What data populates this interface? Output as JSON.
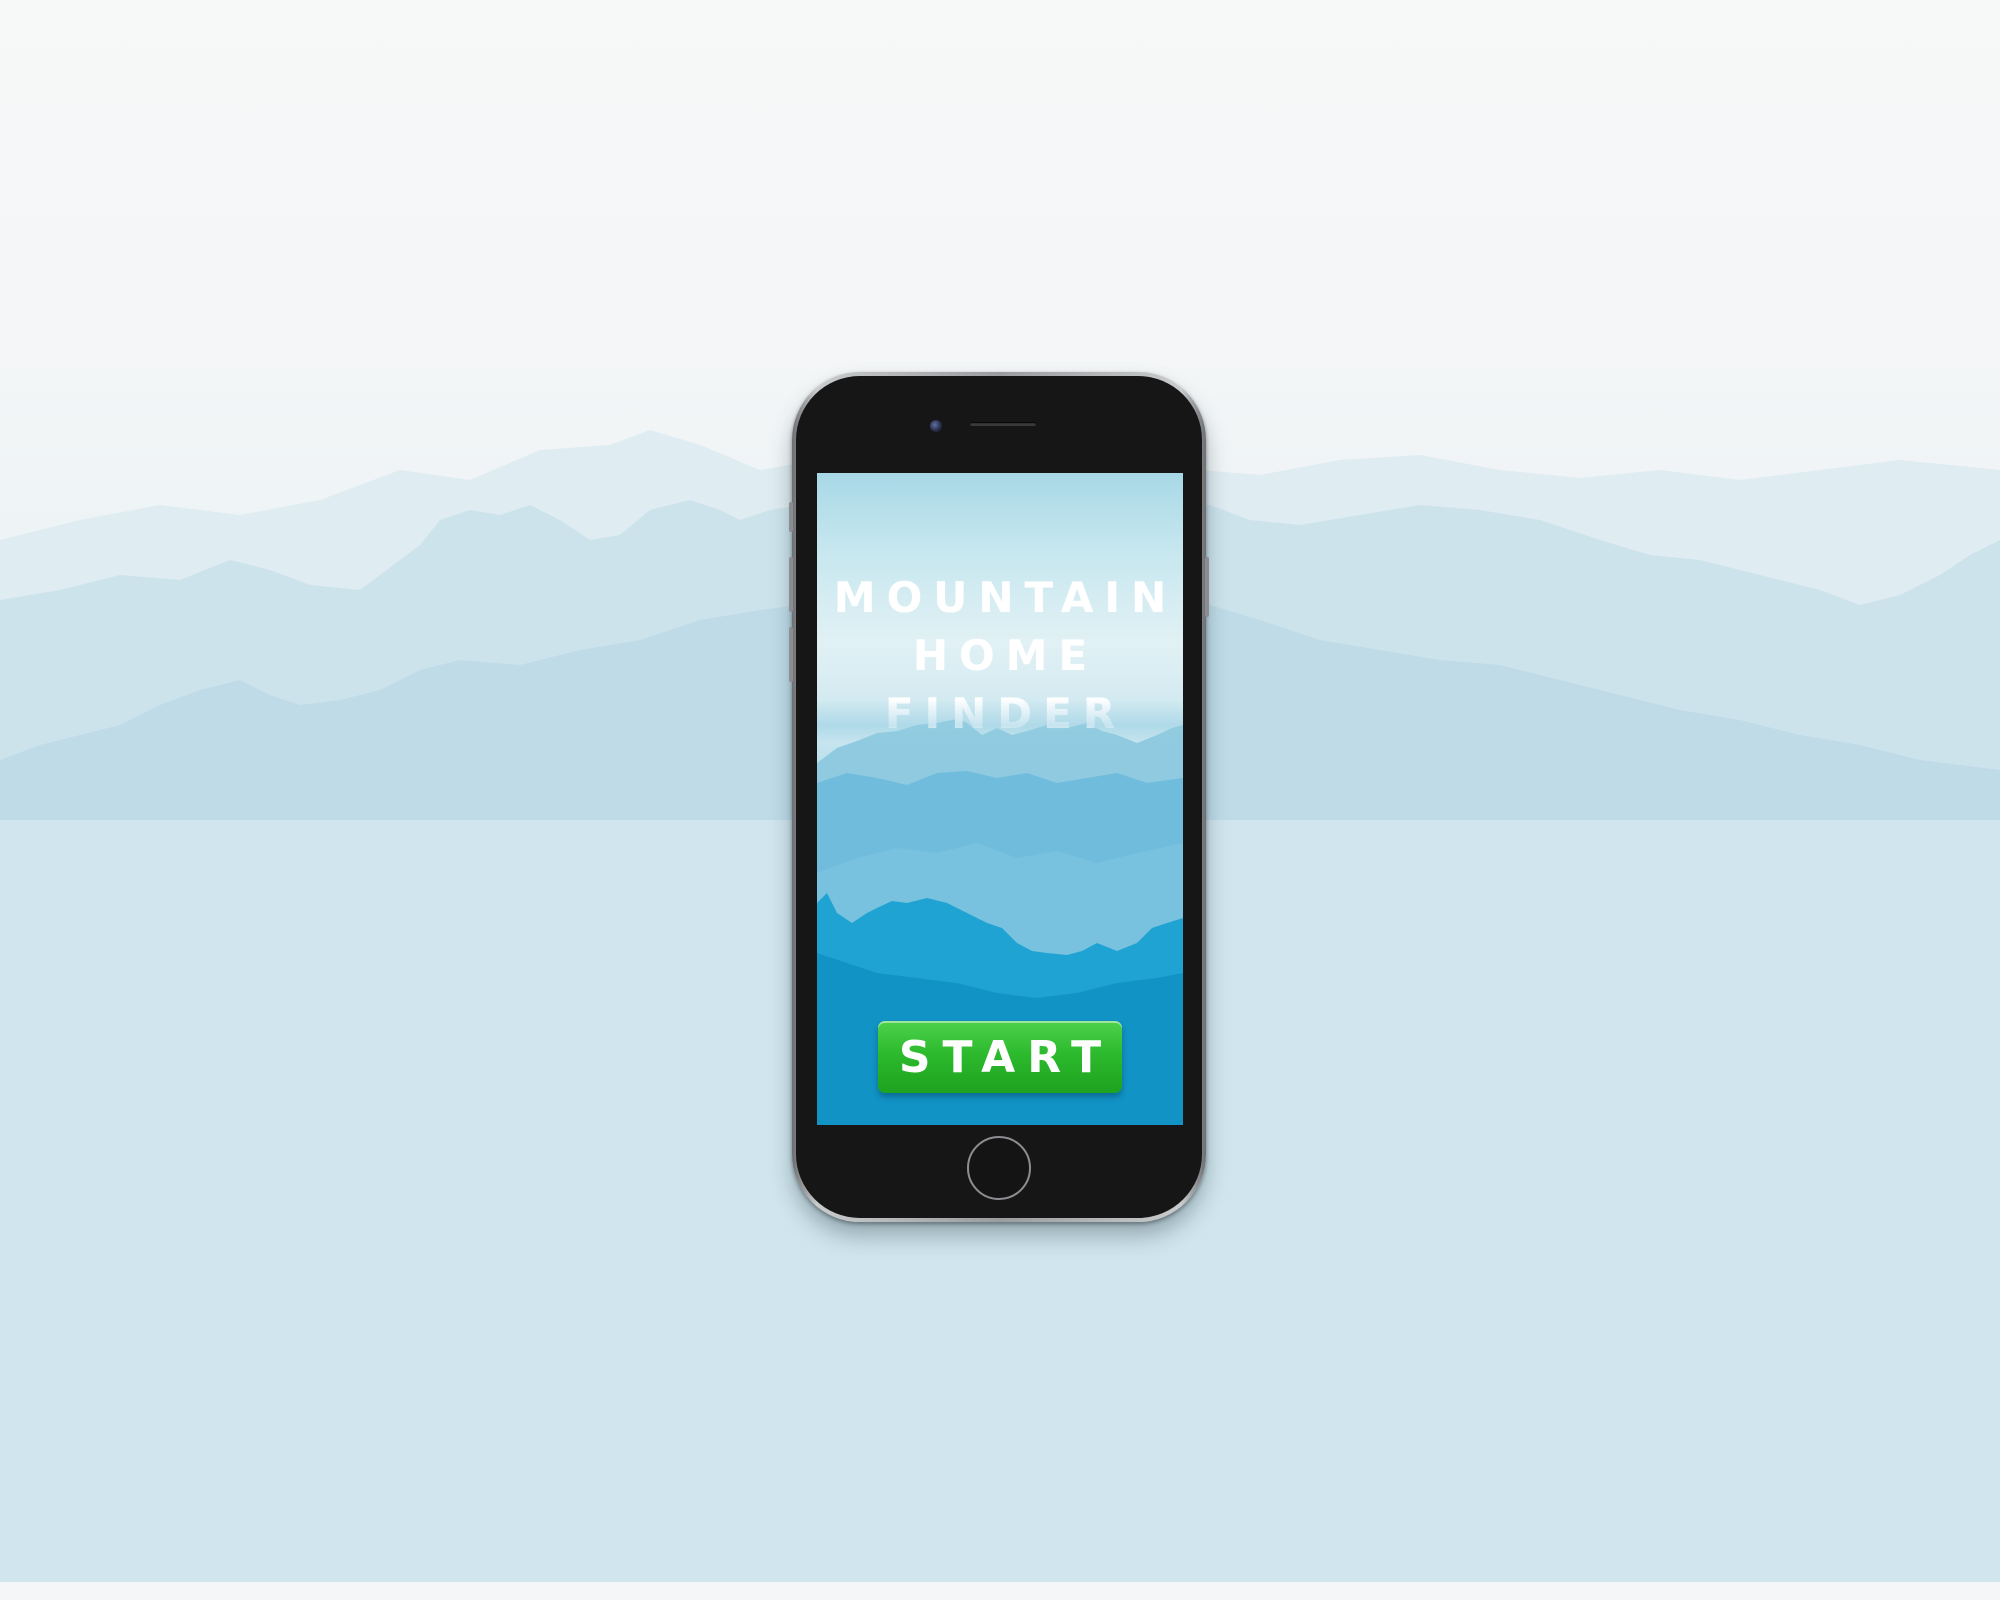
{
  "background": {
    "colors": {
      "sky": "#f6f7f7",
      "mist": "#dcecf2",
      "ridge_far": "#cfe3ec",
      "ridge_mid": "#bfdcea",
      "ridge_near": "#b4d6e6"
    }
  },
  "phone": {
    "colors": {
      "frame": "#9a9c9f",
      "body": "#161616"
    },
    "icons": {
      "camera": "front-camera-icon",
      "speaker": "earpiece-speaker-icon",
      "home": "home-button-icon"
    },
    "app": {
      "title_lines": [
        "MOUNTAIN",
        "HOME",
        "FINDER"
      ],
      "start_label": "START",
      "colors": {
        "title": "#ffffff",
        "start_button": "#2dba2d",
        "start_text": "#ffffff",
        "screen_top": "#a7d8e6",
        "screen_bottom": "#1a93c7"
      }
    }
  }
}
